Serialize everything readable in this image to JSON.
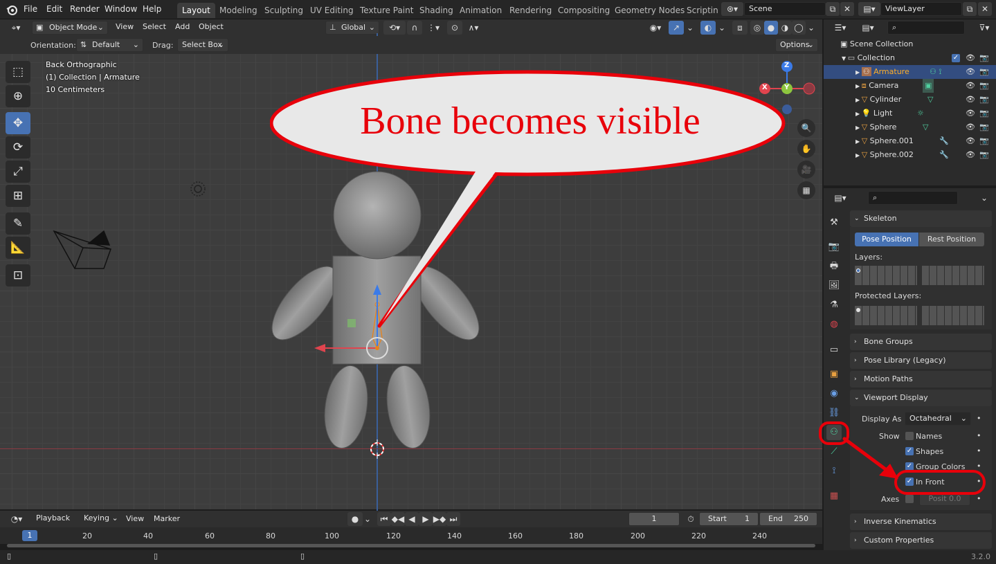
{
  "topbar": {
    "menus": [
      "File",
      "Edit",
      "Render",
      "Window",
      "Help"
    ],
    "workspaces": [
      "Layout",
      "Modeling",
      "Sculpting",
      "UV Editing",
      "Texture Paint",
      "Shading",
      "Animation",
      "Rendering",
      "Compositing",
      "Geometry Nodes",
      "Scripting"
    ],
    "active_workspace": "Layout",
    "scene": "Scene",
    "view_layer": "ViewLayer"
  },
  "viewport_header": {
    "mode": "Object Mode",
    "menus": [
      "View",
      "Select",
      "Add",
      "Object"
    ],
    "transform_orientation": "Global",
    "orientation_label": "Orientation:",
    "orientation_value": "Default",
    "drag_label": "Drag:",
    "drag_value": "Select Box",
    "options": "Options"
  },
  "viewport": {
    "view_name": "Back Orthographic",
    "collection_info": "(1) Collection | Armature",
    "scale_info": "10 Centimeters",
    "gizmo_axes": {
      "z": "Z",
      "y": "Y",
      "x": "X"
    }
  },
  "annotation": {
    "callout": "Bone becomes visible",
    "color": "#e8000a"
  },
  "outliner": {
    "scene_collection": "Scene Collection",
    "collection": "Collection",
    "objects": [
      {
        "name": "Armature",
        "icon": "armature-icon",
        "selected": true
      },
      {
        "name": "Camera",
        "icon": "camera-icon",
        "selected": false
      },
      {
        "name": "Cylinder",
        "icon": "mesh-icon",
        "selected": false
      },
      {
        "name": "Light",
        "icon": "light-icon",
        "selected": false
      },
      {
        "name": "Sphere",
        "icon": "mesh-icon",
        "selected": false
      },
      {
        "name": "Sphere.001",
        "icon": "mesh-icon",
        "selected": false
      },
      {
        "name": "Sphere.002",
        "icon": "mesh-icon",
        "selected": false
      }
    ]
  },
  "properties": {
    "skeleton": {
      "title": "Skeleton",
      "pose_position": "Pose Position",
      "rest_position": "Rest Position",
      "layers_label": "Layers:",
      "protected_layers_label": "Protected Layers:"
    },
    "panels": {
      "bone_groups": "Bone Groups",
      "pose_library": "Pose Library (Legacy)",
      "motion_paths": "Motion Paths",
      "viewport_display": "Viewport Display",
      "inverse_kinematics": "Inverse Kinematics",
      "custom_properties": "Custom Properties"
    },
    "viewport_display": {
      "display_as_label": "Display As",
      "display_as_value": "Octahedral",
      "show_label": "Show",
      "names": {
        "label": "Names",
        "checked": false
      },
      "shapes": {
        "label": "Shapes",
        "checked": true
      },
      "group_colors": {
        "label": "Group Colors",
        "checked": true
      },
      "in_front": {
        "label": "In Front",
        "checked": true
      },
      "axes_label": "Axes",
      "position_label": "Posit",
      "position_value": "0.0"
    }
  },
  "timeline": {
    "menus": [
      "Playback",
      "Keying",
      "View",
      "Marker"
    ],
    "current_frame": "1",
    "start_label": "Start",
    "start_value": "1",
    "end_label": "End",
    "end_value": "250",
    "ruler_ticks": [
      "1",
      "20",
      "40",
      "60",
      "80",
      "100",
      "120",
      "140",
      "160",
      "180",
      "200",
      "220",
      "240"
    ]
  },
  "statusbar": {
    "version": "3.2.0"
  }
}
